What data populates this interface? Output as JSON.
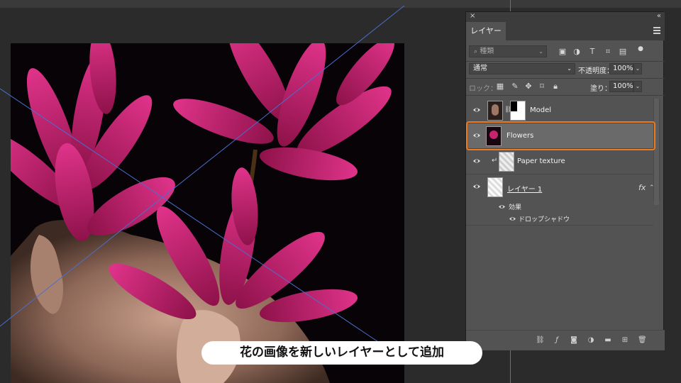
{
  "panel": {
    "close_icon": "×",
    "collapse_icon": "«",
    "tab_label": "レイヤー",
    "filter": {
      "placeholder": "種類"
    },
    "blend_mode": "通常",
    "opacity_label": "不透明度：",
    "opacity_value": "100%",
    "lock_label": "ロック：",
    "fill_label": "塗り：",
    "fill_value": "100%",
    "layers": [
      {
        "name": "Model",
        "visible": true,
        "selected": false
      },
      {
        "name": "Flowers",
        "visible": true,
        "selected": true
      },
      {
        "name": "Paper texture",
        "visible": true,
        "selected": false,
        "clipped": true
      },
      {
        "name": "レイヤー 1",
        "visible": true,
        "selected": false,
        "fx": "fx"
      }
    ],
    "effects_label": "効果",
    "drop_shadow_label": "ドロップシャドウ"
  },
  "caption": "花の画像を新しいレイヤーとして追加",
  "colors": {
    "highlight": "#ec7b1e",
    "flower": "#c8246e",
    "guide": "#4a6fcf",
    "panel_bg": "#535353"
  },
  "icons": [
    "eye-icon",
    "link-icon",
    "fx-icon",
    "trash-icon",
    "new-layer-icon",
    "folder-icon",
    "adjustment-icon",
    "mask-icon",
    "lock-icon"
  ]
}
